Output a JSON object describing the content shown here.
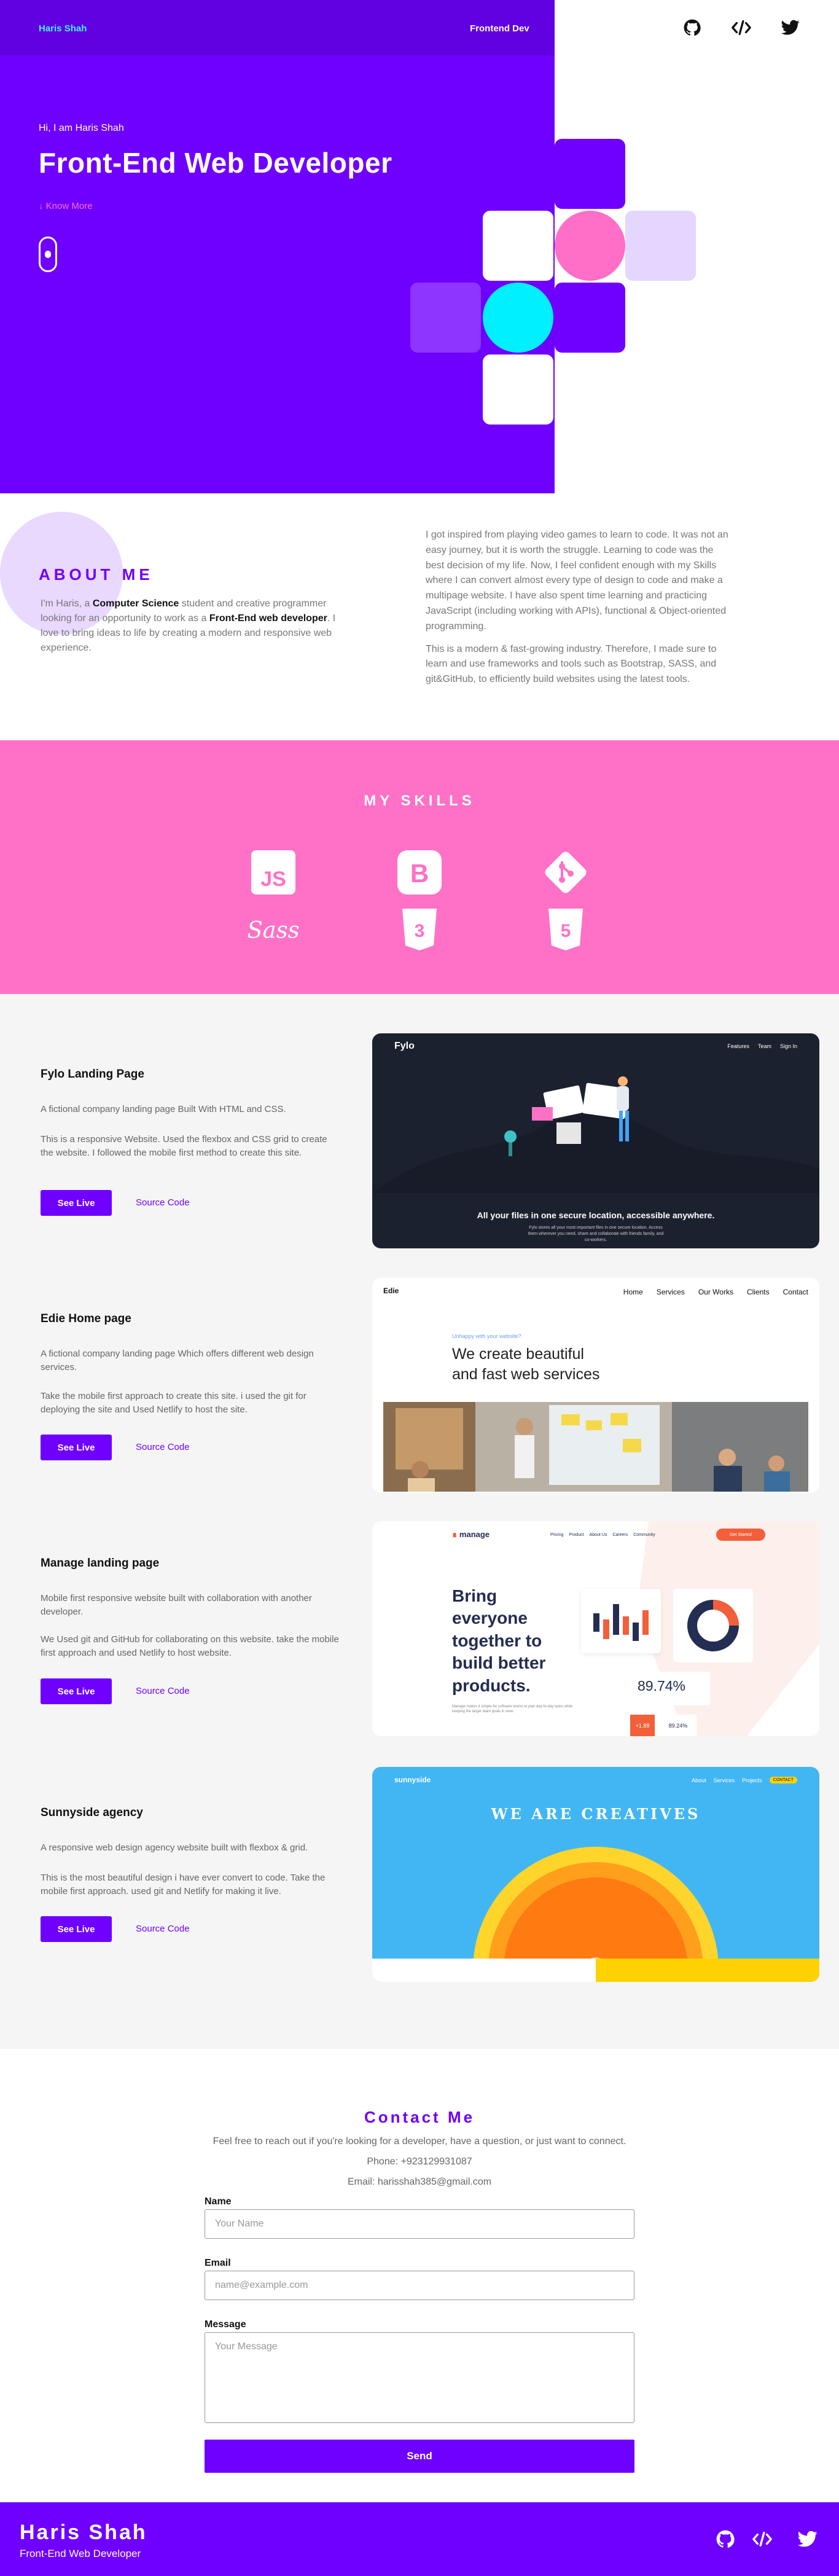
{
  "header": {
    "brand": "Haris Shah",
    "role": "Frontend Dev",
    "social": [
      "github-icon",
      "code-icon",
      "twitter-icon"
    ]
  },
  "hero": {
    "greeting": "Hi, I am Haris Shah",
    "title": "Front-End Web Developer",
    "know_more": "Know More"
  },
  "about": {
    "heading": "ABOUT ME",
    "intro_1": "I'm Haris, a ",
    "intro_bold_1": "Computer Science",
    "intro_2": " student and creative programmer looking for an opportunity to work as a ",
    "intro_bold_2": "Front-End web developer",
    "intro_3": ". I love to bring ideas to life by creating a modern and responsive web experience.",
    "para_1": "I got inspired from playing video games to learn to code. It was not an easy journey, but it is worth the struggle. Learning to code was the best decision of my life. Now, I feel confident enough with my Skills where I can convert almost every type of design to code and make a multipage website. I have also spent time learning and practicing JavaScript (including working with APIs), functional & Object-oriented programming.",
    "para_2": "This is a modern & fast-growing industry. Therefore, I made sure to learn and use frameworks and tools such as Bootstrap, SASS, and git&GitHub, to efficiently build websites using the latest tools."
  },
  "skills": {
    "heading": "MY SKILLS",
    "items": [
      "javascript-icon",
      "bootstrap-icon",
      "git-icon",
      "sass-icon",
      "css3-icon",
      "html5-icon"
    ]
  },
  "projects": [
    {
      "title": "Fylo Landing Page",
      "desc_1": "A fictional company landing page Built With HTML and CSS.",
      "desc_2": "This is a responsive Website. Used the flexbox and CSS grid to create the website. I followed the mobile first method to create this site.",
      "live": "See Live",
      "source": "Source Code",
      "shot": {
        "logo": "Fylo",
        "nav": [
          "Features",
          "Team",
          "Sign In"
        ],
        "headline": "All your files in one secure location, accessible anywhere.",
        "sub": "Fylo stores all your most important files in one secure location. Access them wherever you need, share and collaborate with friends family, and co-workers."
      }
    },
    {
      "title": "Edie Home page",
      "desc_1": "A fictional company landing page Which offers different web design services.",
      "desc_2": "Take the mobile first approach to create this site. i used the git for deploying the site and Used Netlify to host the site.",
      "live": "See Live",
      "source": "Source Code",
      "shot": {
        "logo": "Edie",
        "nav": [
          "Home",
          "Services",
          "Our Works",
          "Clients",
          "Contact"
        ],
        "tag": "Unhappy with your website?",
        "headline_1": "We create beautiful",
        "headline_2": "and fast web services"
      }
    },
    {
      "title": "Manage landing page",
      "desc_1": "Mobile first responsive website built with collaboration with another developer.",
      "desc_2": "We Used git and GitHub for collaborating on this website. take the mobile first approach and used Netlify to host website.",
      "live": "See Live",
      "source": "Source Code",
      "shot": {
        "logo": "manage",
        "nav": [
          "Pricing",
          "Product",
          "About Us",
          "Careers",
          "Community"
        ],
        "cta": "Get Started",
        "headline": "Bring everyone together to build better products.",
        "sub": "Manage makes it simple for software teams to plan day-to-day tasks while keeping the larger team goals in view.",
        "stat": "89.74%",
        "stat_small": "89.24%",
        "stat_tag": "+1.88"
      }
    },
    {
      "title": "Sunnyside agency",
      "desc_1": "A responsive web design agency website built with flexbox & grid.",
      "desc_2": "This is the most beautiful design i have ever convert to code. Take the mobile first approach. used git and Netlify for making it live.",
      "live": "See Live",
      "source": "Source Code",
      "shot": {
        "logo": "sunnyside",
        "nav": [
          "About",
          "Services",
          "Projects"
        ],
        "cta": "CONTACT",
        "headline": "WE ARE CREATIVES"
      }
    }
  ],
  "contact": {
    "heading": "Contact Me",
    "intro": "Feel free to reach out if you're looking for a developer, have a question, or just want to connect.",
    "phone": "Phone: +923129931087",
    "email": "Email: harisshah385@gmail.com",
    "name_label": "Name",
    "name_placeholder": "Your Name",
    "email_label": "Email",
    "email_placeholder": "name@example.com",
    "message_label": "Message",
    "message_placeholder": "Your Message",
    "send": "Send"
  },
  "footer": {
    "name": "Haris Shah",
    "role": "Front-End Web Developer"
  },
  "colors": {
    "primary": "#6f00ff",
    "pink": "#ff71c7",
    "cyan": "#00f0ff",
    "lavender": "#e9d8ff"
  }
}
